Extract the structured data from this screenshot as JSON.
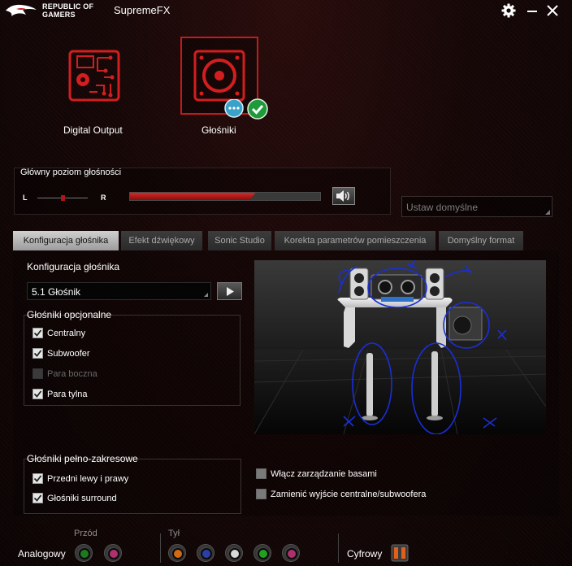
{
  "app": {
    "brand_line1": "REPUBLIC OF",
    "brand_line2": "GAMERS",
    "title": "SupremeFX",
    "accent": "#c51a1a"
  },
  "devices": [
    {
      "label": "Digital Output",
      "icon": "circuit-board-icon",
      "selected": false
    },
    {
      "label": "Głośniki",
      "icon": "speaker-icon",
      "selected": true
    }
  ],
  "volume": {
    "title": "Główny poziom głośności",
    "left": "L",
    "right": "R",
    "level": 0.66,
    "balance": 0.47
  },
  "default_button": "Ustaw domyślne",
  "tabs": [
    {
      "label": "Konfiguracja głośnika",
      "active": true
    },
    {
      "label": "Efekt dźwiękowy",
      "active": false
    },
    {
      "label": "Sonic Studio",
      "active": false
    },
    {
      "label": "Korekta parametrów pomieszczenia",
      "active": false
    },
    {
      "label": "Domyślny format",
      "active": false
    }
  ],
  "config": {
    "label": "Konfiguracja głośnika",
    "selected": "5.1 Głośnik"
  },
  "optional": {
    "title": "Głośniki opcjonalne",
    "items": [
      {
        "label": "Centralny",
        "checked": true,
        "enabled": true
      },
      {
        "label": "Subwoofer",
        "checked": true,
        "enabled": true
      },
      {
        "label": "Para boczna",
        "checked": false,
        "enabled": false
      },
      {
        "label": "Para tylna",
        "checked": true,
        "enabled": true
      }
    ]
  },
  "fullrange": {
    "title": "Głośniki pełno-zakresowe",
    "items": [
      {
        "label": "Przedni lewy i prawy",
        "checked": true
      },
      {
        "label": "Głośniki surround",
        "checked": true
      }
    ]
  },
  "extra": [
    {
      "label": "Włącz zarządzanie basami",
      "checked": false
    },
    {
      "label": "Zamienić wyjście centralne/subwoofera",
      "checked": false
    }
  ],
  "bottom": {
    "analog_label": "Analogowy",
    "front_label": "Przód",
    "rear_label": "Tył",
    "digital_label": "Cyfrowy",
    "front_jacks": [
      "#1f7a1f",
      "#b0306e"
    ],
    "rear_jacks": [
      "#d06a15",
      "#2c3fa6",
      "#d8d8d8",
      "#24a020",
      "#b0306e"
    ]
  }
}
